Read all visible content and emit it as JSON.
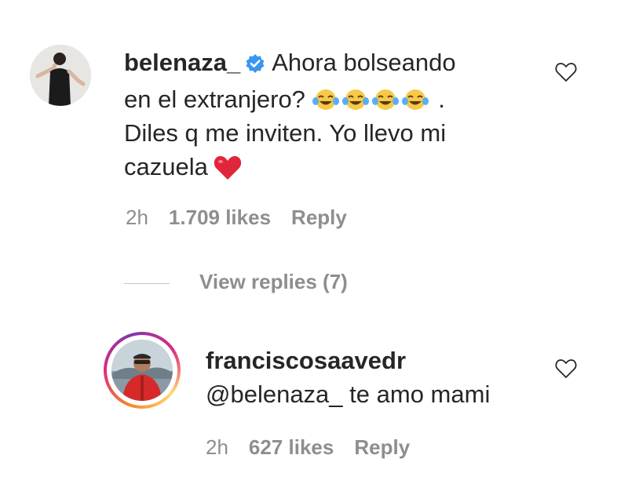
{
  "comments": [
    {
      "username": "belenaza_",
      "verified": true,
      "text_line1": "Ahora bolseando",
      "text_line2_a": "en el extranjero?",
      "text_line2_b": ".",
      "text_line3": "Diles q me inviten. Yo llevo mi",
      "text_line4": "cazuela",
      "time": "2h",
      "likes": "1.709 likes",
      "reply_label": "Reply"
    },
    {
      "username": "franciscosaavedr",
      "mention": "@belenaza_",
      "text": "te amo mami",
      "time": "2h",
      "likes": "627 likes",
      "reply_label": "Reply"
    }
  ],
  "view_replies": "View replies (7)",
  "colors": {
    "text": "#262626",
    "secondary": "#8e8e8e",
    "verified": "#3897f0",
    "heart_emoji": "#e0263a"
  }
}
